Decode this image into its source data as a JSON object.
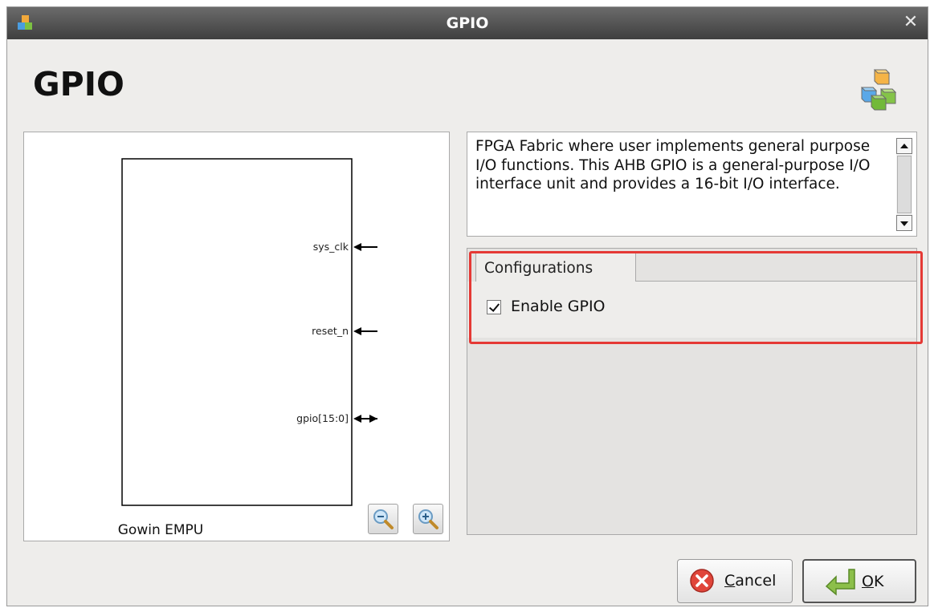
{
  "window": {
    "title": "GPIO",
    "close_icon": "close-icon",
    "app_icon": "cubes-icon"
  },
  "header": {
    "title": "GPIO",
    "icon": "cubes-icon"
  },
  "preview": {
    "caption": "Gowin EMPU",
    "ports": [
      {
        "name": "sys_clk",
        "direction": "input"
      },
      {
        "name": "reset_n",
        "direction": "input"
      },
      {
        "name": "gpio[15:0]",
        "direction": "inout"
      }
    ],
    "zoom_out_icon": "zoom-out-icon",
    "zoom_in_icon": "zoom-in-icon"
  },
  "description": {
    "text": "FPGA Fabric where user implements general purpose I/O functions. This AHB GPIO is a general-purpose I/O interface unit and provides a 16-bit I/O interface."
  },
  "configurations": {
    "tab_label": "Configurations",
    "enable_gpio": {
      "label": "Enable GPIO",
      "checked": true
    }
  },
  "buttons": {
    "cancel": {
      "label_prefix": "C",
      "label_rest": "ancel",
      "icon": "cancel-icon"
    },
    "ok": {
      "label_prefix": "O",
      "label_rest": "K",
      "icon": "ok-arrow-icon"
    }
  },
  "colors": {
    "highlight": "#e53935",
    "title_bar": "#4a4a4a",
    "tab_accent": "#5f93c8"
  }
}
